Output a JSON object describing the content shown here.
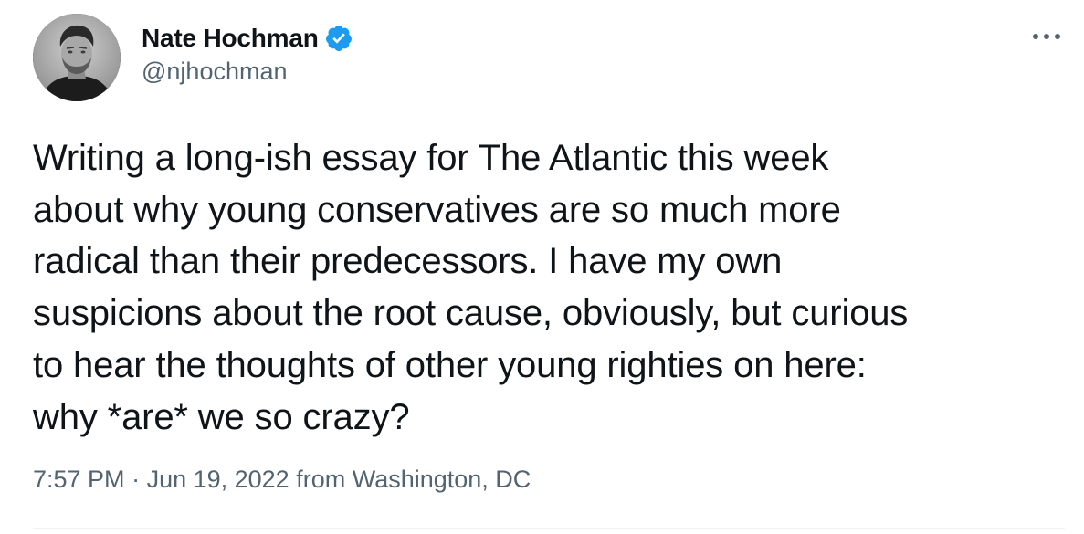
{
  "author": {
    "display_name": "Nate Hochman",
    "handle": "@njhochman",
    "verified": true,
    "verified_color": "#1d9bf0",
    "avatar_icon": "profile-photo"
  },
  "tweet": {
    "lines": [
      "Writing a long-ish essay for The Atlantic this week",
      "about why young conservatives are so much more",
      "radical than their predecessors. I have my own",
      "suspicions about the root cause, obviously, but curious",
      "to hear the thoughts of other young righties on here:",
      "why *are* we so crazy?"
    ]
  },
  "meta": {
    "time": "7:57 PM",
    "separator": " · ",
    "date": "Jun 19, 2022",
    "from_label": " from ",
    "location": "Washington, DC"
  },
  "menu": {
    "more_icon": "more-horizontal-icon"
  },
  "colors": {
    "text_primary": "#0f1419",
    "text_secondary": "#536471",
    "divider": "#eff3f4"
  }
}
